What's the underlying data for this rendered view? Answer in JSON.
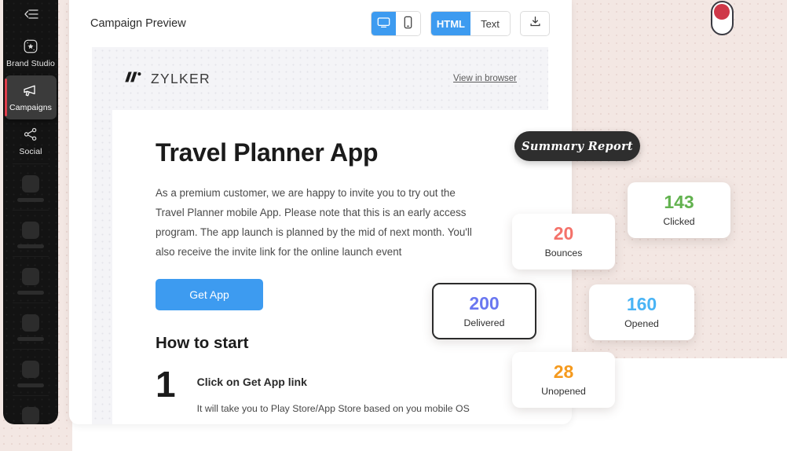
{
  "sidebar": {
    "collapse_icon": "collapse-left-icon",
    "items": [
      {
        "label": "Brand Studio",
        "icon": "star-badge-icon",
        "active": false
      },
      {
        "label": "Campaigns",
        "icon": "megaphone-icon",
        "active": true
      },
      {
        "label": "Social",
        "icon": "share-nodes-icon",
        "active": false
      }
    ],
    "placeholder_count": 6,
    "active_accent": "#e03c4a"
  },
  "toolbar": {
    "title": "Campaign Preview",
    "device_toggle": {
      "desktop": "desktop-icon",
      "mobile": "mobile-icon",
      "selected": "desktop"
    },
    "format_toggle": {
      "html_label": "HTML",
      "text_label": "Text",
      "selected": "HTML"
    },
    "download_icon": "download-icon"
  },
  "email": {
    "brand_name": "ZYLKER",
    "logo_icon": "zylker-logo-icon",
    "view_in_browser": "View in browser",
    "heading": "Travel Planner App",
    "paragraph": "As a premium customer, we are happy to invite you to try out the Travel Planner mobile App. Please note that this is an early access program. The app launch is planned by the mid of next month. You'll also receive the invite link for the online launch event",
    "cta_label": "Get App",
    "cta_color": "#3d9bf0",
    "how_to_start": "How to start",
    "step": {
      "number": "1",
      "title": "Click on Get App link",
      "description": "It will take you to Play Store/App Store based on you mobile OS"
    }
  },
  "summary": {
    "badge_label": "Summary Report",
    "cards": [
      {
        "id": "clicked",
        "value": "143",
        "label": "Clicked",
        "color": "#62b24f",
        "outlined": false
      },
      {
        "id": "bounces",
        "value": "20",
        "label": "Bounces",
        "color": "#f4726a",
        "outlined": false
      },
      {
        "id": "delivered",
        "value": "200",
        "label": "Delivered",
        "color": "#6a77f0",
        "outlined": true
      },
      {
        "id": "opened",
        "value": "160",
        "label": "Opened",
        "color": "#4ab4f5",
        "outlined": false
      },
      {
        "id": "unopened",
        "value": "28",
        "label": "Unopened",
        "color": "#f59a1e",
        "outlined": false
      }
    ]
  },
  "toggle_switch": {
    "name": "record-toggle",
    "state": "on",
    "knob_color": "#cf3748"
  }
}
